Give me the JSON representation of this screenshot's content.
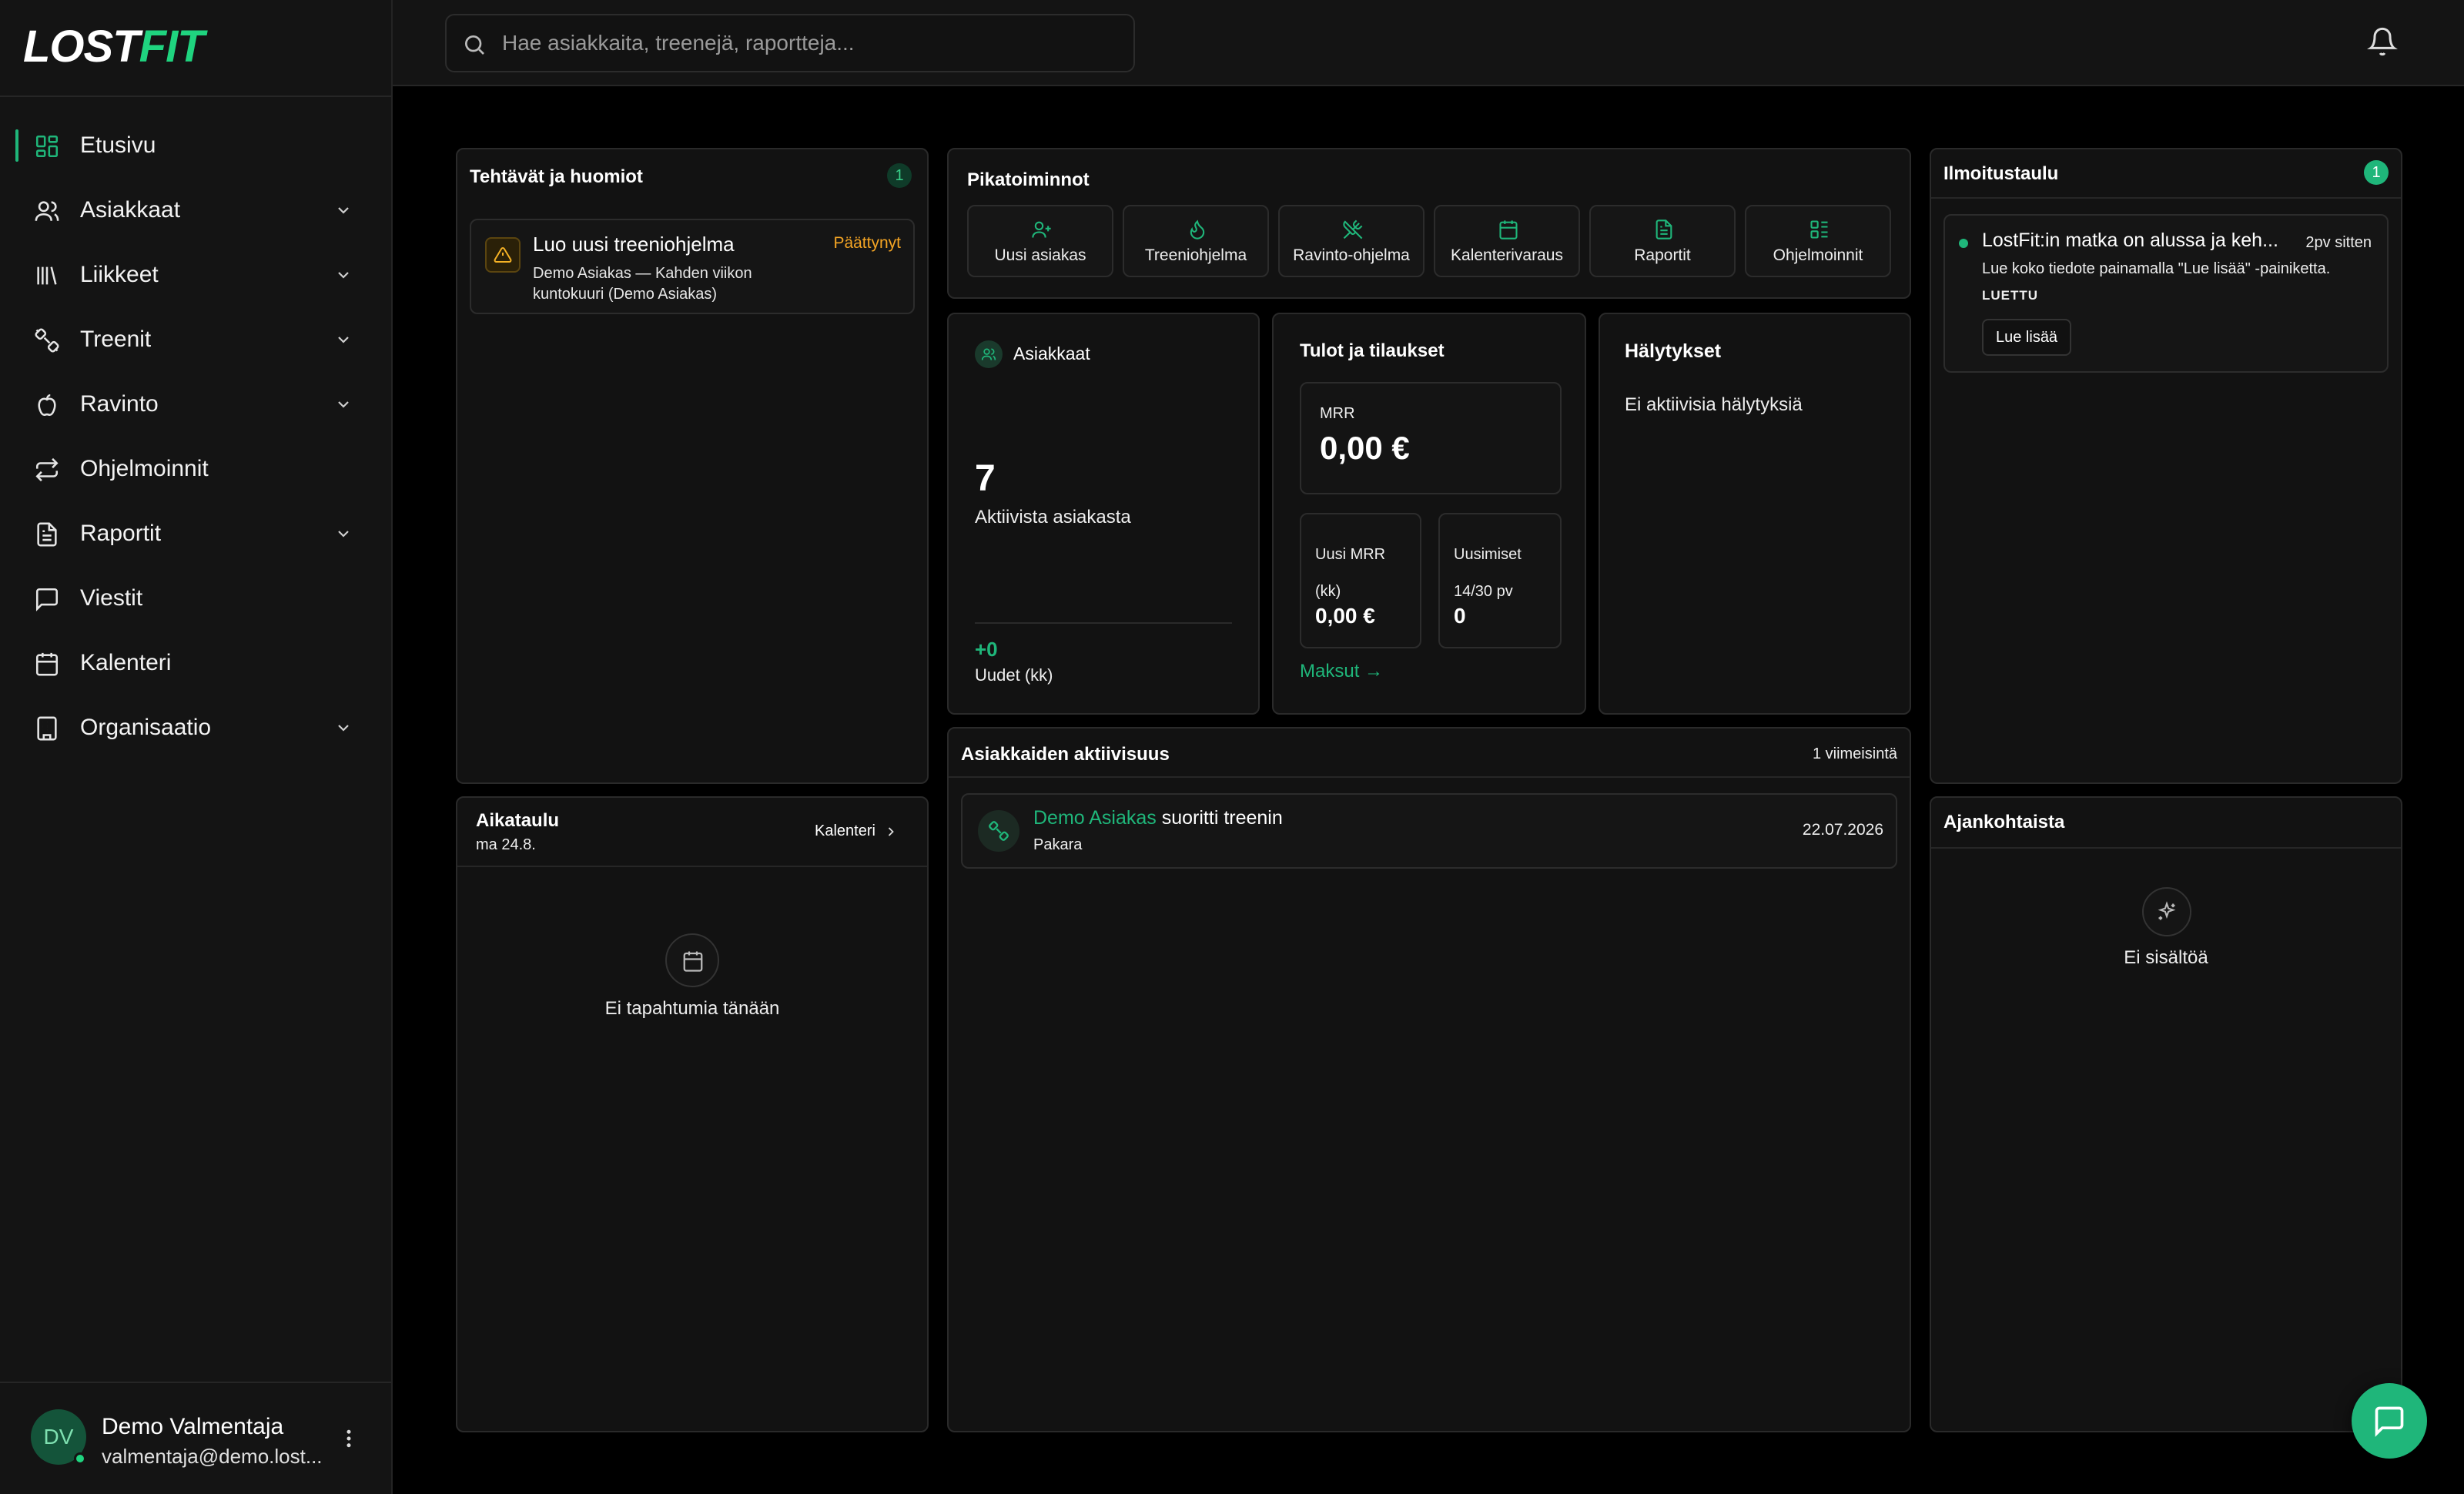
{
  "brand": {
    "logo_a": "LOST",
    "logo_b": "FIT"
  },
  "search": {
    "placeholder": "Hae asiakkaita, treenejä, raportteja..."
  },
  "nav": {
    "items": [
      {
        "label": "Etusivu",
        "icon": "dashboard-icon",
        "active": true
      },
      {
        "label": "Asiakkaat",
        "icon": "users-icon",
        "expandable": true
      },
      {
        "label": "Liikkeet",
        "icon": "library-icon",
        "expandable": true
      },
      {
        "label": "Treenit",
        "icon": "dumbbell-icon",
        "expandable": true
      },
      {
        "label": "Ravinto",
        "icon": "apple-icon",
        "expandable": true
      },
      {
        "label": "Ohjelmoinnit",
        "icon": "repeat-icon"
      },
      {
        "label": "Raportit",
        "icon": "report-icon",
        "expandable": true
      },
      {
        "label": "Viestit",
        "icon": "message-icon"
      },
      {
        "label": "Kalenteri",
        "icon": "calendar-icon"
      },
      {
        "label": "Organisaatio",
        "icon": "building-icon",
        "expandable": true
      }
    ]
  },
  "user": {
    "initials": "DV",
    "name": "Demo Valmentaja",
    "email": "valmentaja@demo.lost..."
  },
  "tasks": {
    "title": "Tehtävät ja huomiot",
    "count": "1",
    "items": [
      {
        "title": "Luo uusi treeniohjelma",
        "status": "Päättynyt",
        "desc": "Demo Asiakas — Kahden viikon kuntokuuri (Demo Asiakas)"
      }
    ]
  },
  "quick_actions": {
    "title": "Pikatoiminnot",
    "items": [
      {
        "label": "Uusi asiakas",
        "icon": "user-plus-icon"
      },
      {
        "label": "Treeniohjelma",
        "icon": "flame-icon"
      },
      {
        "label": "Ravinto-ohjelma",
        "icon": "utensils-icon"
      },
      {
        "label": "Kalenterivaraus",
        "icon": "calendar-icon"
      },
      {
        "label": "Raportit",
        "icon": "report-icon"
      },
      {
        "label": "Ohjelmoinnit",
        "icon": "list-icon"
      }
    ]
  },
  "clients": {
    "title": "Asiakkaat",
    "value": "7",
    "caption": "Aktiivista asiakasta",
    "delta": "+0",
    "delta_label": "Uudet (kk)"
  },
  "revenue": {
    "title": "Tulot ja tilaukset",
    "mrr_label": "MRR",
    "mrr_value": "0,00 €",
    "new_mrr_label": "Uusi MRR (kk)",
    "new_mrr_value": "0,00 €",
    "renewals_label": "Uusimiset 14/30 pv",
    "renewals_value": "0",
    "payments_link": "Maksut →"
  },
  "alerts": {
    "title": "Hälytykset",
    "empty": "Ei aktiivisia hälytyksiä"
  },
  "notice": {
    "title": "Ilmoitustaulu",
    "count": "1",
    "item": {
      "title": "LostFit:in matka on alussa ja keh...",
      "time": "2pv sitten",
      "body": "Lue koko tiedote painamalla \"Lue lisää\" -painiketta.",
      "tag": "LUETTU",
      "button": "Lue lisää"
    }
  },
  "schedule": {
    "title": "Aikataulu",
    "date": "ma 24.8.",
    "link": "Kalenteri",
    "empty": "Ei tapahtumia tänään"
  },
  "activity": {
    "title": "Asiakkaiden aktiivisuus",
    "meta": "1 viimeisintä",
    "items": [
      {
        "client": "Demo Asiakas",
        "action": "suoritti treenin",
        "detail": "Pakara",
        "date": "22.07.2026"
      }
    ]
  },
  "news": {
    "title": "Ajankohtaista",
    "empty": "Ei sisältöä"
  },
  "colors": {
    "accent": "#1fb67a",
    "warning": "#f5a524",
    "background": "#000000",
    "card": "#121212"
  }
}
